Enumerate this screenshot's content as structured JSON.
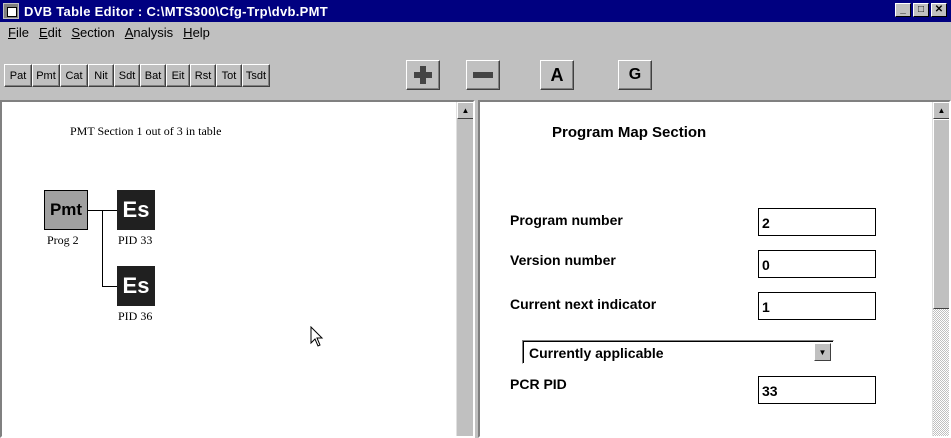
{
  "window": {
    "title": "DVB Table Editor : C:\\MTS300\\Cfg-Trp\\dvb.PMT",
    "minimize": "_",
    "maximize": "□",
    "close": "✕"
  },
  "menu": [
    {
      "pre": "",
      "ul": "F",
      "post": "ile"
    },
    {
      "pre": "",
      "ul": "E",
      "post": "dit"
    },
    {
      "pre": "",
      "ul": "S",
      "post": "ection"
    },
    {
      "pre": "",
      "ul": "A",
      "post": "nalysis"
    },
    {
      "pre": "",
      "ul": "H",
      "post": "elp"
    }
  ],
  "toolbar": {
    "tables": [
      "Pat",
      "Pmt",
      "Cat",
      "Nit",
      "Sdt",
      "Bat",
      "Eit",
      "Rst",
      "Tot",
      "Tsdt"
    ],
    "a_label": "A",
    "g_label": "G"
  },
  "tree": {
    "caption": "PMT Section 1 out of 3 in table",
    "pmt": {
      "label": "Pmt",
      "sub": "Prog 2"
    },
    "es": [
      {
        "label": "Es",
        "pid": "PID 33"
      },
      {
        "label": "Es",
        "pid": "PID 36"
      }
    ]
  },
  "form": {
    "title": "Program Map Section",
    "program_number": {
      "label": "Program number",
      "value": "2"
    },
    "version_number": {
      "label": "Version number",
      "value": "0"
    },
    "current_next": {
      "label": "Current next indicator",
      "value": "1"
    },
    "applicability": "Currently applicable",
    "pcr_pid": {
      "label": "PCR PID",
      "value": "33"
    }
  },
  "colors": {
    "titlebar": "#000080",
    "face": "#c0c0c0",
    "pmt_node": "#a0a0a0",
    "es_node": "#202020"
  }
}
